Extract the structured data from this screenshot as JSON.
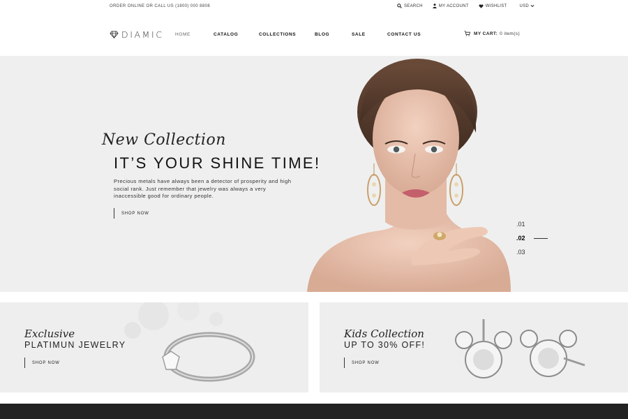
{
  "topbar": {
    "phone": "ORDER ONLINE OR CALL US (1800) 000 8808",
    "search": "SEARCH",
    "account": "MY ACCOUNT",
    "wishlist": "WISHLIST",
    "currency": "USD"
  },
  "header": {
    "logo": "DIAMIC",
    "nav": [
      "HOME",
      "CATALOG",
      "COLLECTIONS",
      "BLOG",
      "SALE",
      "CONTACT US"
    ],
    "cart_label": "MY CART:",
    "cart_count": "0 item(s)"
  },
  "hero": {
    "kicker": "New Collection",
    "title": "IT’S YOUR SHINE TIME!",
    "description": "Precious metals have always been a detector of prosperity and high social rank. Just remember that jewelry was always a very inaccessible good for ordinary people.",
    "cta": "SHOP NOW",
    "slides": [
      ".01",
      ".02",
      ".03"
    ],
    "active_slide": 2
  },
  "banners": [
    {
      "kicker": "Exclusive",
      "title": "PLATIMUN JEWELRY",
      "cta": "SHOP NOW"
    },
    {
      "kicker": "Kids Collection",
      "title": "UP TO 30% OFF!",
      "cta": "SHOP NOW"
    }
  ]
}
